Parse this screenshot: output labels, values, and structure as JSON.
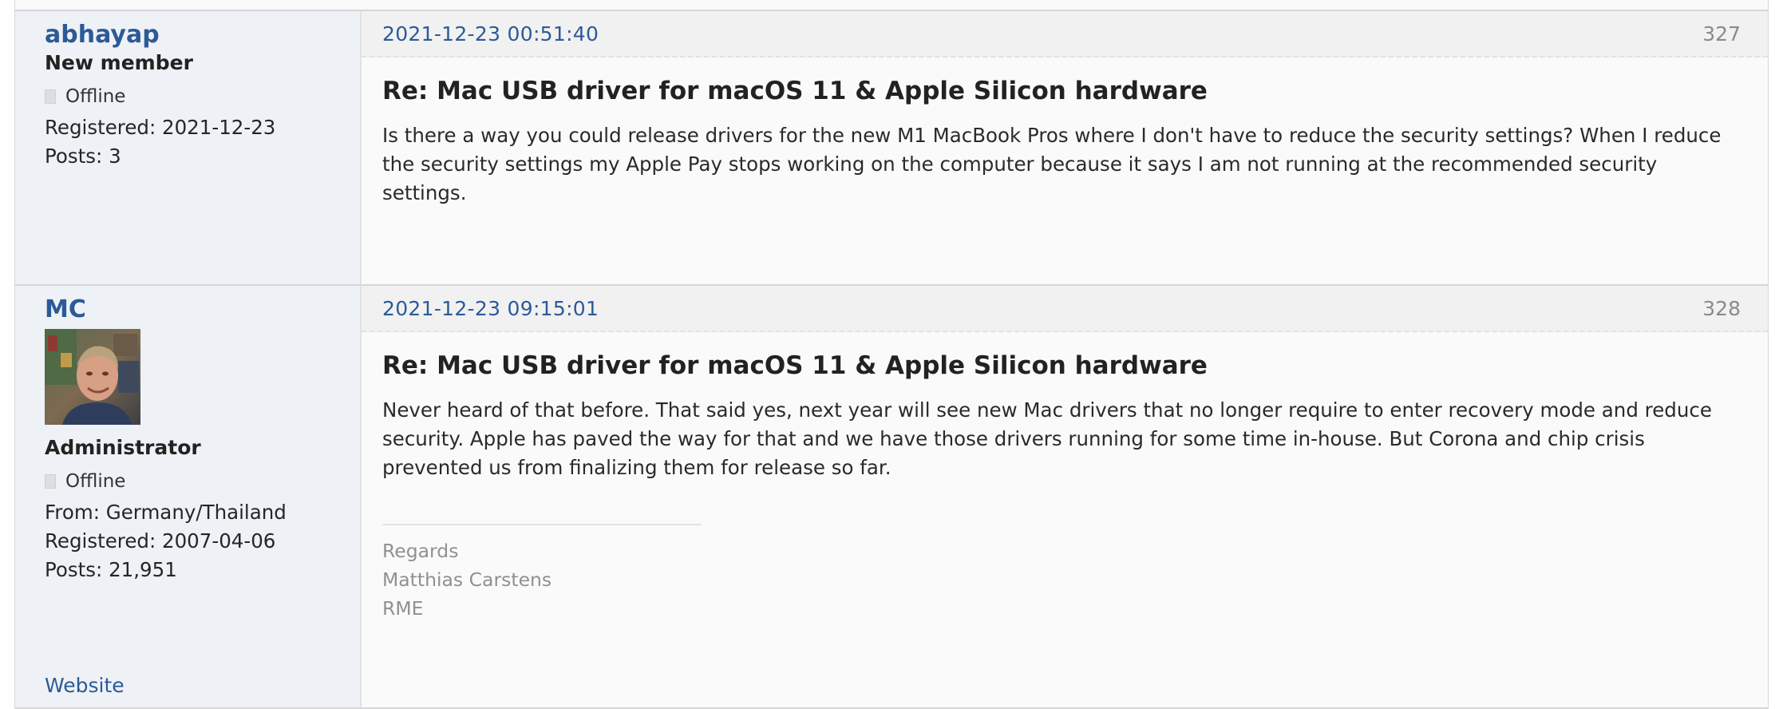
{
  "posts": [
    {
      "author": {
        "name": "abhayap",
        "title": "New member",
        "status": "Offline",
        "registered": "Registered: 2021-12-23",
        "posts": "Posts: 3"
      },
      "date": "2021-12-23 00:51:40",
      "number": "327",
      "subject": "Re: Mac USB driver for macOS 11 & Apple Silicon hardware",
      "body": "Is there a way you could release drivers for the new M1 MacBook Pros where I don't have to reduce the security settings? When I reduce the security settings my Apple Pay stops working on the computer because it says I am not running at the recommended security settings."
    },
    {
      "author": {
        "name": "MC",
        "title": "Administrator",
        "status": "Offline",
        "from": "From: Germany/Thailand",
        "registered": "Registered: 2007-04-06",
        "posts": "Posts: 21,951",
        "website": "Website"
      },
      "date": "2021-12-23 09:15:01",
      "number": "328",
      "subject": "Re: Mac USB driver for macOS 11 & Apple Silicon hardware",
      "body": "Never heard of that before. That said yes, next year will see new Mac drivers that no longer require to enter recovery mode and reduce security. Apple has paved the way for that and we have those drivers running for some time in-house. But Corona and chip crisis prevented us from finalizing them for release so far.",
      "signature": [
        "Regards",
        "Matthias Carstens",
        "RME"
      ]
    }
  ],
  "icons": {
    "status": "offline-status-icon",
    "avatar": "user-avatar-photo"
  },
  "colors": {
    "link": "#2c5a98",
    "sidebar_bg": "#eef1f5",
    "header_bg": "#f1f1f1",
    "signature_text": "#909090"
  }
}
